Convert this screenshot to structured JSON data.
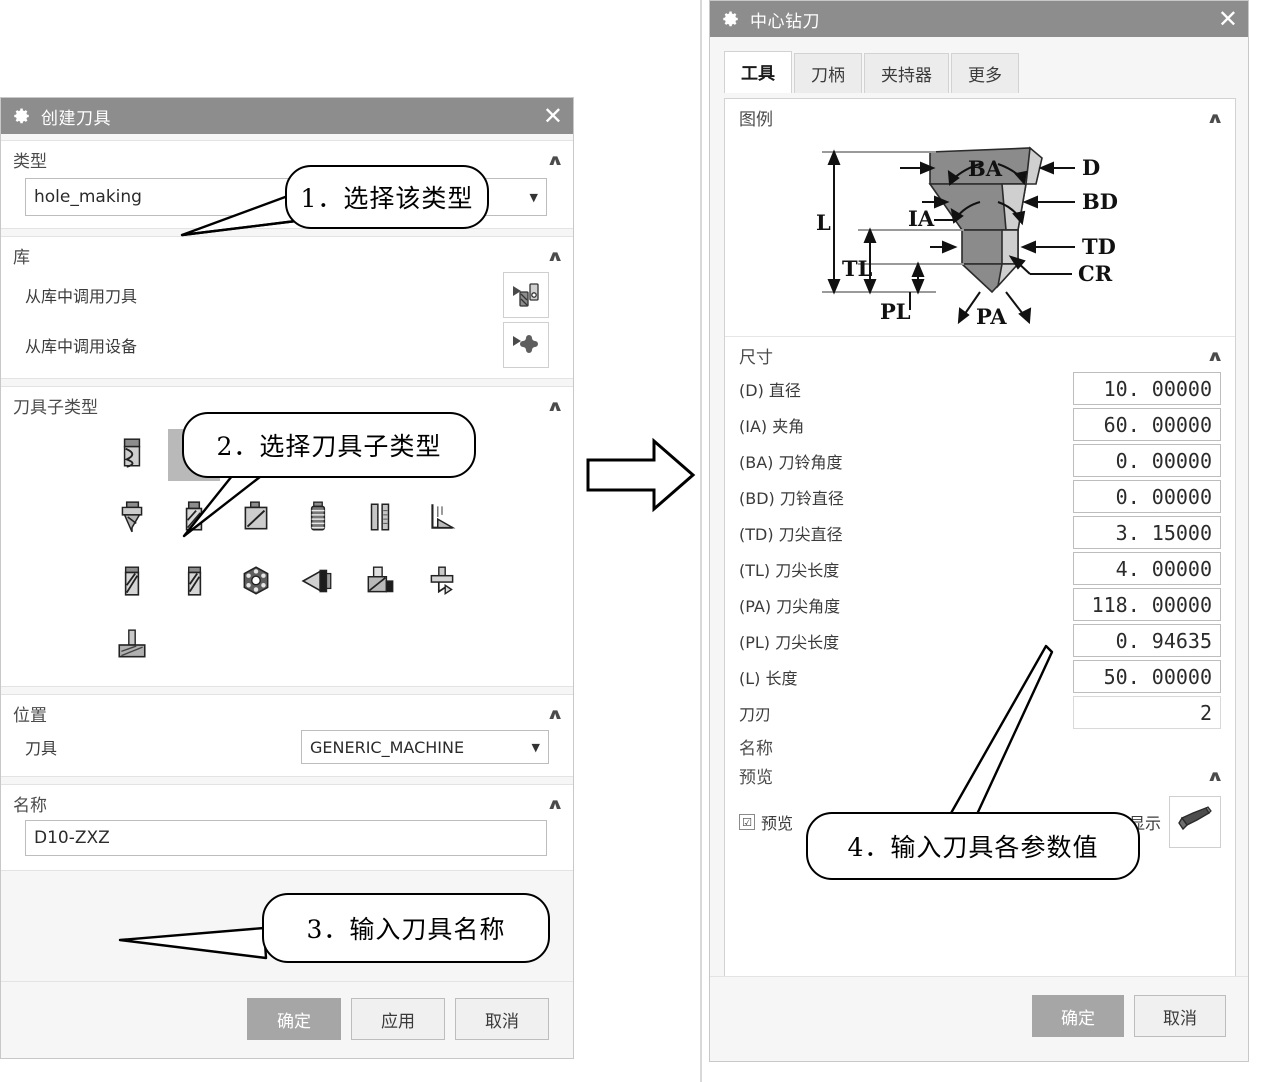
{
  "left_dialog": {
    "title": "创建刀具",
    "icon": "gear-icon",
    "close": "✕",
    "type_section": {
      "title": "类型",
      "value": "hole_making",
      "collapse": "∧"
    },
    "library_section": {
      "title": "库",
      "rows": [
        {
          "label": "从库中调用刀具",
          "icon": "tool-library-icon"
        },
        {
          "label": "从库中调用设备",
          "icon": "device-library-icon"
        }
      ],
      "collapse": "∧"
    },
    "subtype_section": {
      "title": "刀具子类型",
      "collapse": "∧",
      "selected_index": 1,
      "icons": [
        "twist-drill-icon",
        "center-drill-icon",
        "spot-drill-icon",
        "step-drill-icon",
        "core-drill-icon",
        "reamer-icon",
        "countersink-icon",
        "counterbore-icon",
        "boring-bar-icon",
        "tap-icon",
        "back-spotface-icon",
        "chamfer-mill-icon",
        "drill-spiral-icon",
        "drill-spiral2-icon",
        "indexable-drill-icon",
        "engraving-tool-icon",
        "thread-mill-icon",
        "t-cutter-icon",
        "t-slot-icon"
      ]
    },
    "position_section": {
      "title": "位置",
      "collapse": "∧",
      "row_label": "刀具",
      "value": "GENERIC_MACHINE"
    },
    "name_section": {
      "title": "名称",
      "collapse": "∧",
      "value": "D10-ZXZ"
    },
    "footer": {
      "ok": "确定",
      "apply": "应用",
      "cancel": "取消"
    }
  },
  "right_dialog": {
    "title": "中心钻刀",
    "icon": "gear-icon",
    "close": "✕",
    "tabs": [
      {
        "label": "工具",
        "active": true
      },
      {
        "label": "刀柄",
        "active": false
      },
      {
        "label": "夹持器",
        "active": false
      },
      {
        "label": "更多",
        "active": false
      }
    ],
    "legend_section": {
      "title": "图例",
      "collapse": "∧",
      "labels": [
        "L",
        "BA",
        "D",
        "BD",
        "IA",
        "TL",
        "TD",
        "CR",
        "PL",
        "PA"
      ]
    },
    "dimensions_section": {
      "title": "尺寸",
      "collapse": "∧",
      "fields": [
        {
          "label": "(D) 直径",
          "value": "10. 00000"
        },
        {
          "label": "(IA) 夹角",
          "value": "60. 00000"
        },
        {
          "label": "(BA) 刀铃角度",
          "value": "0. 00000"
        },
        {
          "label": "(BD) 刀铃直径",
          "value": "0. 00000"
        },
        {
          "label": "(TD) 刀尖直径",
          "value": "3. 15000"
        },
        {
          "label": "(TL) 刀尖长度",
          "value": "4. 00000"
        },
        {
          "label": "(PA) 刀尖角度",
          "value": "118. 00000"
        },
        {
          "label": "(PL) 刀尖长度",
          "value": "0. 94635"
        },
        {
          "label": "(L) 长度",
          "value": "50. 00000"
        },
        {
          "label": "刀刃",
          "value": "2"
        }
      ]
    },
    "name_section": {
      "title": "名称"
    },
    "preview_section": {
      "title": "预览",
      "collapse": "∧",
      "checkbox_label": "预览",
      "checkbox_checked": "☑",
      "display_label": "显示",
      "display_icon": "tool-preview-icon"
    },
    "footer": {
      "ok": "确定",
      "cancel": "取消"
    }
  },
  "callouts": [
    {
      "id": "callout-1",
      "text": "1．选择该类型"
    },
    {
      "id": "callout-2",
      "text": "2．选择刀具子类型"
    },
    {
      "id": "callout-3",
      "text": "3．输入刀具名称"
    },
    {
      "id": "callout-4",
      "text": "4．输入刀具各参数值"
    }
  ],
  "flow_arrow": {
    "name": "flow-arrow-right"
  },
  "colors": {
    "titlebar": "#8d8d8d",
    "panel": "#f6f6f6",
    "selection": "#b9b9b9",
    "primary_button": "#a6a6a6"
  }
}
